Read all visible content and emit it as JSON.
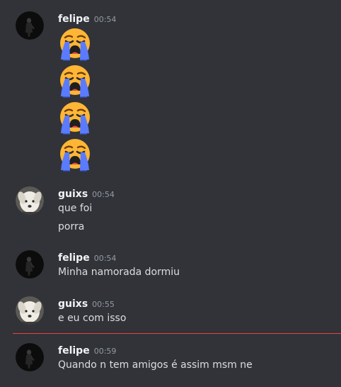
{
  "messages": [
    {
      "username": "felipe",
      "time": "00:54",
      "avatar_icon": "dark-figure-avatar",
      "emoji_name": "loudly-crying-face-emoji",
      "emoji_count": 4
    },
    {
      "username": "guixs",
      "time": "00:54",
      "avatar_icon": "white-dog-avatar",
      "lines": [
        "que foi",
        "porra"
      ]
    },
    {
      "username": "felipe",
      "time": "00:54",
      "avatar_icon": "dark-figure-avatar",
      "lines": [
        "Minha namorada dormiu"
      ]
    },
    {
      "username": "guixs",
      "time": "00:55",
      "avatar_icon": "white-dog-avatar",
      "lines": [
        "e eu com isso"
      ]
    },
    {
      "username": "felipe",
      "time": "00:59",
      "avatar_icon": "dark-figure-avatar",
      "lines": [
        "Quando n tem amigos é assim msm ne"
      ]
    }
  ],
  "colors": {
    "background": "#313338",
    "username": "#f2f3f5",
    "timestamp": "#949ba4",
    "text": "#dbdee1",
    "new_messages_divider": "#f23f42"
  }
}
